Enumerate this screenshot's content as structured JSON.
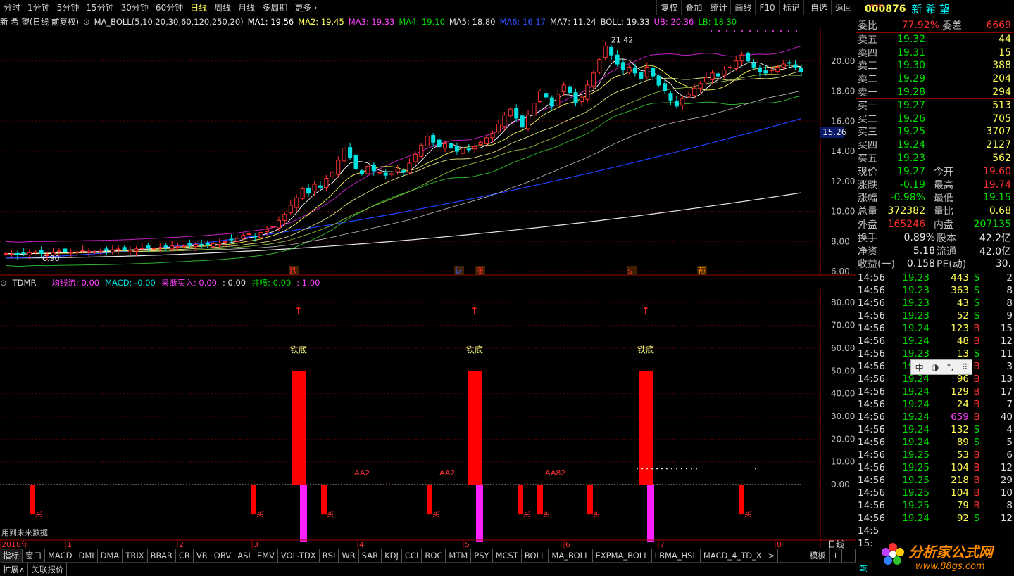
{
  "toolbar": {
    "items": [
      "分时",
      "1分钟",
      "5分钟",
      "15分钟",
      "30分钟",
      "60分钟",
      "日线",
      "周线",
      "月线",
      "多周期",
      "更多 ›"
    ],
    "right_items": [
      "复权",
      "叠加",
      "统计",
      "画线",
      "F10",
      "标记",
      "-自选",
      "返回"
    ]
  },
  "main_info": {
    "title": "新 希 望(日线 前复权)",
    "indicator": "MA_BOLL(5,10,20,30,60,120,250,20)",
    "ma1": "MA1: 19.56",
    "ma2": "MA2: 19.45",
    "ma3": "MA3: 19.33",
    "ma4": "MA4: 19.10",
    "ma5": "MA5: 18.80",
    "ma6": "MA6: 16.17",
    "ma7": "MA7: 11.24",
    "boll": "BOLL: 19.33",
    "ub": "UB: 20.36",
    "lb": "LB: 18.30"
  },
  "main_axis": {
    "ticks": [
      "20.00",
      "18.00",
      "16.00",
      "14.00",
      "12.00",
      "10.00",
      "8.00",
      "6.00"
    ],
    "marker": "15.26",
    "high_label": "21.42",
    "low_label": "6.90"
  },
  "events": [
    "跌",
    "财",
    "涨",
    "$",
    "预"
  ],
  "sub_info": {
    "name": "TDMR",
    "jxl": "均线流: 0.00",
    "macd": "MACD: -0.00",
    "gdmr": "果断买入: 0.00",
    "zero": ": 0.00",
    "jp": "井喷: 0.00",
    "one": ": 1.00"
  },
  "sub_axis": {
    "ticks": [
      "80.00",
      "70.00",
      "60.00",
      "50.00",
      "40.00",
      "30.00",
      "20.00",
      "10.00",
      "0.00"
    ]
  },
  "sub_labels": {
    "tiedi": "铁底",
    "buy": "买",
    "aa82": "AA82",
    "aa": "AA2",
    "note": "用到未来数据"
  },
  "time_axis": {
    "labels": [
      "2018年",
      "1",
      "2",
      "3",
      "4",
      "5",
      "6",
      "7",
      "8"
    ],
    "period": "日线"
  },
  "tabs": [
    "指标",
    "窗口",
    "MACD",
    "DMI",
    "DMA",
    "TRIX",
    "BRAR",
    "CR",
    "VR",
    "OBV",
    "ASI",
    "EMV",
    "VOL-TDX",
    "RSI",
    "WR",
    "SAR",
    "KDJ",
    "CCI",
    "ROC",
    "MTM",
    "PSY",
    "MCST",
    "BOLL",
    "MA_BOLL",
    "EXPMA_BOLL",
    "LBMA_HSL",
    "MACD_4_TD_X",
    ">"
  ],
  "tabs_right": [
    "模板",
    "+",
    "−"
  ],
  "status": [
    "扩展∧",
    "关联报价"
  ],
  "stock": {
    "code": "000876",
    "name": "新 希 望",
    "badge": "R 300"
  },
  "weibi": {
    "label1": "委比",
    "val1": "77.92%",
    "label2": "委差",
    "val2": "6669"
  },
  "asks": [
    {
      "l": "卖五",
      "p": "19.32",
      "v": "44"
    },
    {
      "l": "卖四",
      "p": "19.31",
      "v": "15"
    },
    {
      "l": "卖三",
      "p": "19.30",
      "v": "388"
    },
    {
      "l": "卖二",
      "p": "19.29",
      "v": "204"
    },
    {
      "l": "卖一",
      "p": "19.28",
      "v": "294"
    }
  ],
  "bids": [
    {
      "l": "买一",
      "p": "19.27",
      "v": "513"
    },
    {
      "l": "买二",
      "p": "19.26",
      "v": "705"
    },
    {
      "l": "买三",
      "p": "19.25",
      "v": "3707"
    },
    {
      "l": "买四",
      "p": "19.24",
      "v": "2127"
    },
    {
      "l": "买五",
      "p": "19.23",
      "v": "562"
    }
  ],
  "stats1": [
    {
      "a": "现价",
      "b": "19.27",
      "c": "今开",
      "d": "19.60",
      "bc": "green",
      "dc": "red"
    },
    {
      "a": "涨跌",
      "b": "-0.19",
      "c": "最高",
      "d": "19.74",
      "bc": "green",
      "dc": "red"
    },
    {
      "a": "涨幅",
      "b": "-0.98%",
      "c": "最低",
      "d": "19.15",
      "bc": "green",
      "dc": "green"
    },
    {
      "a": "总量",
      "b": "372382",
      "c": "量比",
      "d": "0.68",
      "bc": "yellow",
      "dc": "yellow"
    },
    {
      "a": "外盘",
      "b": "165246",
      "c": "内盘",
      "d": "207135",
      "bc": "red",
      "dc": "green"
    }
  ],
  "stats2": [
    {
      "a": "换手",
      "b": "0.89%",
      "c": "股本",
      "d": "42.2亿"
    },
    {
      "a": "净资",
      "b": "5.18",
      "c": "流通",
      "d": "42.0亿"
    },
    {
      "a": "收益(一)",
      "b": "0.158",
      "c": "PE(动)",
      "d": "30."
    }
  ],
  "ticks": [
    {
      "t": "14:56",
      "p": "19.23",
      "v": "443",
      "s": "S",
      "n": "2"
    },
    {
      "t": "14:56",
      "p": "19.23",
      "v": "363",
      "s": "S",
      "n": "8"
    },
    {
      "t": "14:56",
      "p": "19.23",
      "v": "43",
      "s": "S",
      "n": "8"
    },
    {
      "t": "14:56",
      "p": "19.23",
      "v": "52",
      "s": "S",
      "n": "9"
    },
    {
      "t": "14:56",
      "p": "19.24",
      "v": "123",
      "s": "B",
      "n": "15"
    },
    {
      "t": "14:56",
      "p": "19.24",
      "v": "48",
      "s": "B",
      "n": "12"
    },
    {
      "t": "14:56",
      "p": "19.23",
      "v": "13",
      "s": "S",
      "n": "11"
    },
    {
      "t": "14:56",
      "p": "19.24",
      "v": "6",
      "s": "B",
      "n": "3"
    },
    {
      "t": "14:56",
      "p": "19.24",
      "v": "96",
      "s": "B",
      "n": "13"
    },
    {
      "t": "14:56",
      "p": "19.24",
      "v": "129",
      "s": "B",
      "n": "17"
    },
    {
      "t": "14:56",
      "p": "19.24",
      "v": "24",
      "s": "B",
      "n": "7"
    },
    {
      "t": "14:56",
      "p": "19.24",
      "v": "659",
      "s": "B",
      "n": "40"
    },
    {
      "t": "14:56",
      "p": "19.24",
      "v": "132",
      "s": "S",
      "n": "4"
    },
    {
      "t": "14:56",
      "p": "19.24",
      "v": "89",
      "s": "S",
      "n": "5"
    },
    {
      "t": "14:56",
      "p": "19.25",
      "v": "53",
      "s": "B",
      "n": "6"
    },
    {
      "t": "14:56",
      "p": "19.25",
      "v": "104",
      "s": "B",
      "n": "12"
    },
    {
      "t": "14:56",
      "p": "19.25",
      "v": "218",
      "s": "B",
      "n": "29"
    },
    {
      "t": "14:56",
      "p": "19.25",
      "v": "104",
      "s": "B",
      "n": "10"
    },
    {
      "t": "14:56",
      "p": "19.25",
      "v": "79",
      "s": "B",
      "n": "8"
    },
    {
      "t": "14:56",
      "p": "19.24",
      "v": "92",
      "s": "S",
      "n": "12"
    },
    {
      "t": "14:5",
      "p": "",
      "v": "",
      "s": "",
      "n": ""
    },
    {
      "t": "15:",
      "p": "",
      "v": "",
      "s": "",
      "n": ""
    }
  ],
  "bottom_tab": "笔",
  "ime": [
    "中",
    "◑",
    "°,",
    "⠿"
  ],
  "logo": {
    "l1": "分析家公式网",
    "l2": "www.88gs.com"
  },
  "chart_data": [
    {
      "type": "candlestick",
      "title": "新 希 望(日线 前复权)",
      "ylim": [
        6.0,
        22.0
      ],
      "yticks": [
        6,
        8,
        10,
        12,
        14,
        16,
        18,
        20
      ],
      "xlabels": [
        "2018年",
        "1",
        "2",
        "3",
        "4",
        "5",
        "6",
        "7",
        "8"
      ],
      "closes": [
        7.2,
        7.15,
        7.1,
        7.2,
        7.25,
        7.3,
        7.2,
        7.15,
        7.25,
        7.35,
        7.3,
        7.25,
        7.3,
        7.4,
        7.35,
        7.3,
        7.35,
        7.4,
        7.45,
        7.5,
        7.45,
        7.4,
        7.5,
        7.55,
        7.6,
        7.55,
        7.6,
        7.65,
        7.7,
        7.65,
        7.7,
        7.75,
        7.8,
        7.75,
        7.8,
        7.85,
        7.9,
        8.0,
        8.1,
        8.2,
        8.4,
        8.5,
        8.3,
        8.6,
        8.8,
        9.0,
        9.4,
        9.8,
        10.4,
        10.9,
        11.5,
        11.2,
        11.8,
        11.6,
        12.2,
        12.6,
        13.4,
        14.2,
        13.6,
        12.8,
        12.5,
        13.0,
        12.7,
        12.6,
        12.4,
        12.5,
        12.8,
        12.6,
        13.2,
        13.8,
        14.4,
        15.0,
        14.6,
        14.3,
        14.5,
        14.2,
        14.0,
        14.2,
        14.1,
        14.3,
        14.6,
        14.9,
        15.2,
        15.8,
        16.4,
        16.8,
        16.2,
        15.6,
        16.4,
        17.2,
        18.0,
        17.6,
        17.0,
        17.8,
        18.4,
        17.9,
        17.2,
        17.6,
        18.4,
        19.2,
        20.1,
        21.0,
        20.4,
        19.8,
        19.4,
        19.6,
        19.2,
        18.8,
        19.6,
        19.0,
        18.4,
        18.0,
        17.4,
        17.0,
        17.5,
        17.8,
        18.2,
        18.5,
        18.9,
        19.2,
        19.0,
        19.4,
        19.6,
        20.0,
        20.4,
        20.0,
        19.6,
        19.3,
        19.2,
        19.4,
        19.6,
        19.8,
        19.9,
        19.6,
        19.27
      ],
      "lines": [
        {
          "name": "MA6",
          "value": 16.17
        },
        {
          "name": "MA7",
          "value": 11.24
        },
        {
          "name": "UB",
          "value": 20.36
        },
        {
          "name": "LB",
          "value": 18.3
        }
      ]
    },
    {
      "type": "bar",
      "title": "TDMR",
      "ylim": [
        -25,
        85
      ],
      "yticks": [
        0,
        10,
        20,
        30,
        40,
        50,
        60,
        70,
        80
      ],
      "bars": [
        {
          "label": "铁底",
          "value": 50
        },
        {
          "label": "铁底",
          "value": 50
        },
        {
          "label": "铁底",
          "value": 50
        }
      ]
    }
  ]
}
